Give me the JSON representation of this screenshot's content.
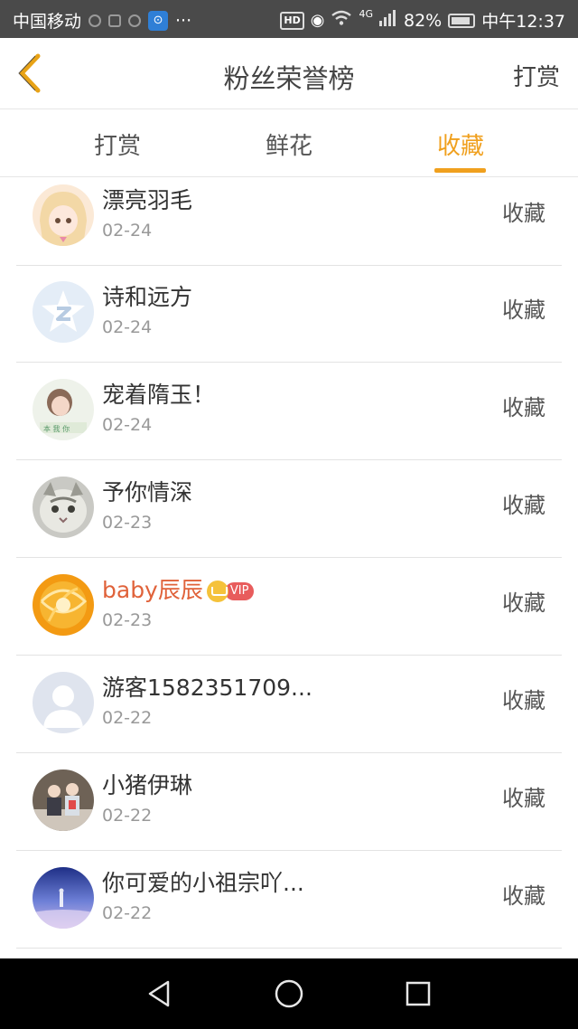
{
  "status_bar": {
    "carrier": "中国移动",
    "battery": "82%",
    "network": "4G",
    "time": "中午12:37",
    "hd_badge": "HD",
    "more": "···"
  },
  "header": {
    "title": "粉丝荣誉榜",
    "action": "打赏"
  },
  "tabs": [
    {
      "label": "打赏",
      "active": false
    },
    {
      "label": "鲜花",
      "active": false
    },
    {
      "label": "收藏",
      "active": true
    }
  ],
  "list": [
    {
      "name": "漂亮羽毛",
      "date": "02-24",
      "action": "收藏"
    },
    {
      "name": "诗和远方",
      "date": "02-24",
      "action": "收藏"
    },
    {
      "name": "宠着隋玉！",
      "date": "02-24",
      "action": "收藏"
    },
    {
      "name": "予你情深",
      "date": "02-23",
      "action": "收藏"
    },
    {
      "name": "baby辰辰",
      "date": "02-23",
      "action": "收藏",
      "vip_badge": "VIP"
    },
    {
      "name": "游客1582351709...",
      "date": "02-22",
      "action": "收藏"
    },
    {
      "name": "小猪伊琳",
      "date": "02-22",
      "action": "收藏"
    },
    {
      "name": "你可爱的小祖宗吖...",
      "date": "02-22",
      "action": "收藏"
    }
  ],
  "colors": {
    "accent": "#f0a01e",
    "vip_name": "#e0623a",
    "vip_badge": "#e85c5c"
  }
}
